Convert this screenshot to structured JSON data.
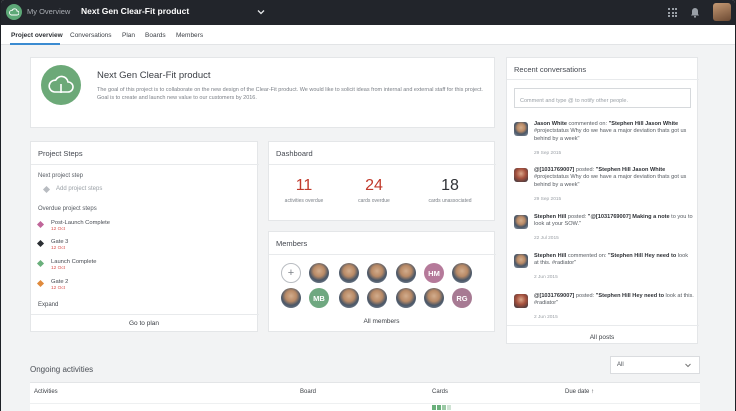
{
  "topbar": {
    "breadcrumb_root": "My Overview",
    "project_name": "Next Gen Clear-Fit product"
  },
  "tabs": [
    "Project overview",
    "Conversations",
    "Plan",
    "Boards",
    "Members"
  ],
  "project": {
    "title": "Next Gen Clear-Fit product",
    "description": "The goal of this project is to collaborate on the new design of the Clear-Fit product. We would like to solicit ideas from internal and external staff for this project. Goal is to create and launch new value to our customers by 2016."
  },
  "steps": {
    "header": "Project Steps",
    "next_label": "Next project step",
    "add_label": "Add project steps",
    "overdue_label": "Overdue project steps",
    "items": [
      {
        "name": "Post-Launch Complete",
        "date": "12 Oct",
        "color": "#c0669a"
      },
      {
        "name": "Gate 3",
        "date": "12 Oct",
        "color": "#2b2e33"
      },
      {
        "name": "Launch Complete",
        "date": "12 Oct",
        "color": "#6ab07c"
      },
      {
        "name": "Gate 2",
        "date": "12 Oct",
        "color": "#e08a3c"
      }
    ],
    "expand": "Expand",
    "go_to_plan": "Go to plan"
  },
  "dashboard": {
    "header": "Dashboard",
    "stats": [
      {
        "value": "11",
        "label": "activities overdue"
      },
      {
        "value": "24",
        "label": "cards overdue"
      },
      {
        "value": "18",
        "label": "cards unassociated"
      }
    ]
  },
  "members": {
    "header": "Members",
    "all_label": "All members",
    "initials": {
      "hm": "HM",
      "mb": "MB",
      "rg": "RG"
    }
  },
  "conversations": {
    "header": "Recent conversations",
    "placeholder": "Comment and type @ to notify other people.",
    "items": [
      {
        "author": "Jason White",
        "verb": " commented on: ",
        "target": "\"Stephen Hill Jason White",
        "body": " #projectstatus Why do we have a major deviation thats got us behind by a week\"",
        "date": "29 Sep 2015"
      },
      {
        "author": "@[1031769007]",
        "verb": " posted: ",
        "target": "\"Stephen Hill Jason White",
        "body": " #projectstatus Why do we have a major deviation thats got us behind by a week\"",
        "date": "29 Sep 2015"
      },
      {
        "author": "Stephen Hill",
        "verb": " posted: ",
        "target": "\"@[1031769007] Making a note",
        "body": " to you to look at your SOW.\"",
        "date": "22 Jul 2015"
      },
      {
        "author": "Stephen Hill",
        "verb": " commented on: ",
        "target": "\"Stephen Hill Hey need to",
        "body": " look at this. #radiator\"",
        "date": "2 Jun 2015"
      },
      {
        "author": "@[1031769007]",
        "verb": " posted: ",
        "target": "\"Stephen Hill Hey need to",
        "body": " look at this. #radiator\"",
        "date": "2 Jun 2015"
      }
    ],
    "all_posts": "All posts"
  },
  "ongoing": {
    "title": "Ongoing activities",
    "filter": "All",
    "columns": [
      "Activities",
      "Board",
      "Cards",
      "Due date"
    ],
    "sort_indicator": "↑"
  },
  "colors": {
    "accent": "#3b8bd1",
    "brand_green": "#6ca978",
    "overdue_red": "#c0392b"
  }
}
